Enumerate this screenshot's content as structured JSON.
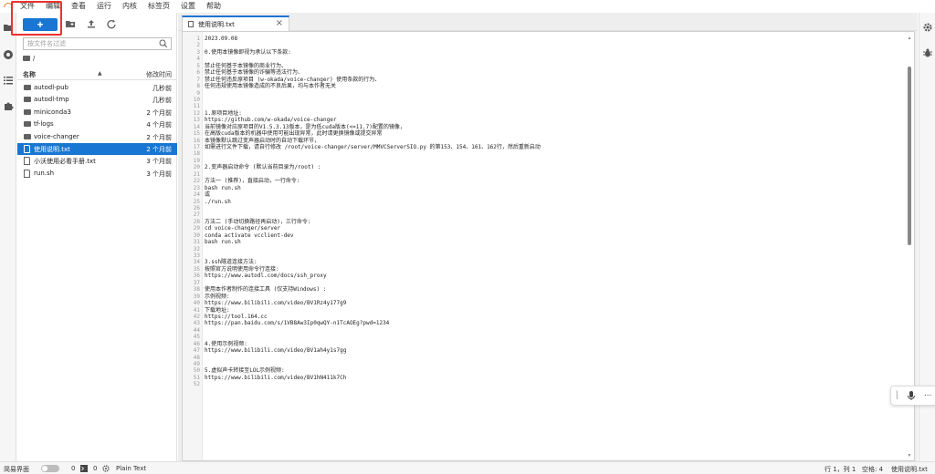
{
  "menu": [
    "文件",
    "编辑",
    "查看",
    "运行",
    "内核",
    "标签页",
    "设置",
    "帮助"
  ],
  "toolbar": {
    "new_label": "+"
  },
  "filebrowser": {
    "search_placeholder": "按文件名过滤",
    "breadcrumb": "/",
    "col_name": "名称",
    "col_modified": "修改时间",
    "items": [
      {
        "name": "autodl-pub",
        "type": "folder",
        "modified": "几秒前",
        "selected": false
      },
      {
        "name": "autodl-tmp",
        "type": "folder",
        "modified": "几秒前",
        "selected": false
      },
      {
        "name": "miniconda3",
        "type": "folder",
        "modified": "2 个月前",
        "selected": false
      },
      {
        "name": "tf-logs",
        "type": "folder",
        "modified": "4 个月前",
        "selected": false
      },
      {
        "name": "voice-changer",
        "type": "folder",
        "modified": "2 个月前",
        "selected": false
      },
      {
        "name": "使用说明.txt",
        "type": "file",
        "modified": "2 个月前",
        "selected": true
      },
      {
        "name": "小沃使用必看手册.txt",
        "type": "file",
        "modified": "3 个月前",
        "selected": false
      },
      {
        "name": "run.sh",
        "type": "file",
        "modified": "3 个月前",
        "selected": false
      }
    ]
  },
  "editor": {
    "tab_title": "使用说明.txt",
    "lines": [
      "2023.09.08",
      "",
      "0.使用本镜像即视为承认以下条款:",
      "",
      "禁止任何基于本镜像的商业行为、",
      "禁止任何基于本镜像的诈骗等违法行为、",
      "禁止任何违反原项目 (w-okada/voice-changer) 使用条款的行为、",
      "任何违规使用本镜像造成的不良后果，均与本作者无关",
      "",
      "",
      "",
      "1.原项目地址:",
      "https://github.com/w-okada/voice-changer",
      "当前镜像对应原项目的V1.5.3.13版本，是为低cuda版本(<=11.7)配置的镜像，",
      "在高版cuda版本的机器中使用可能出现异常，此时请更换镜像或提交异常",
      "本镜像默认跳过变声器启动时的自动下载环节，",
      "如需进行文件下载，请自行修改 /root/voice-changer/server/MMVCServerSIO.py 的第153、154、161、162行，然后重新启动",
      "",
      "",
      "2.变声器启动命令 (默认当前目录为/root) :",
      "",
      "方法一 (推荐)，直接启动，一行命令:",
      "bash run.sh",
      "或",
      "./run.sh",
      "",
      "",
      "方法二 (手动切换路径再启动)，三行命令:",
      "cd voice-changer/server",
      "conda activate vcclient-dev",
      "bash run.sh",
      "",
      "",
      "3.ssh隧道连接方法:",
      "按照官方说明使用命令行连接:",
      "https://www.autodl.com/docs/ssh_proxy",
      "",
      "使用本作者制作的连接工具 (仅支持Windows) :",
      "示例视频:",
      "https://www.bilibili.com/video/BV1Rz4y177g9",
      "下载地址:",
      "https://tool.164.cc",
      "https://pan.baidu.com/s/1VB8Aw3Ip0qwQY-n1TcAOEg?pwd=1234",
      "",
      "",
      "4.使用示例视频:",
      "https://www.bilibili.com/video/BV1ah4y1s7gg",
      "",
      "",
      "5.虚拟声卡转接至LOL示例视频:",
      "https://www.bilibili.com/video/BV1hN411k7Ch",
      ""
    ]
  },
  "ime": {
    "mic_icon": "microphone-icon",
    "more": "..."
  },
  "statusbar": {
    "simple_mode": "简易界面",
    "count1": "0",
    "count2": "0",
    "language": "Plain Text",
    "position": "行 1，列 1",
    "spaces": "空格: 4",
    "filename": "使用说明.txt"
  }
}
